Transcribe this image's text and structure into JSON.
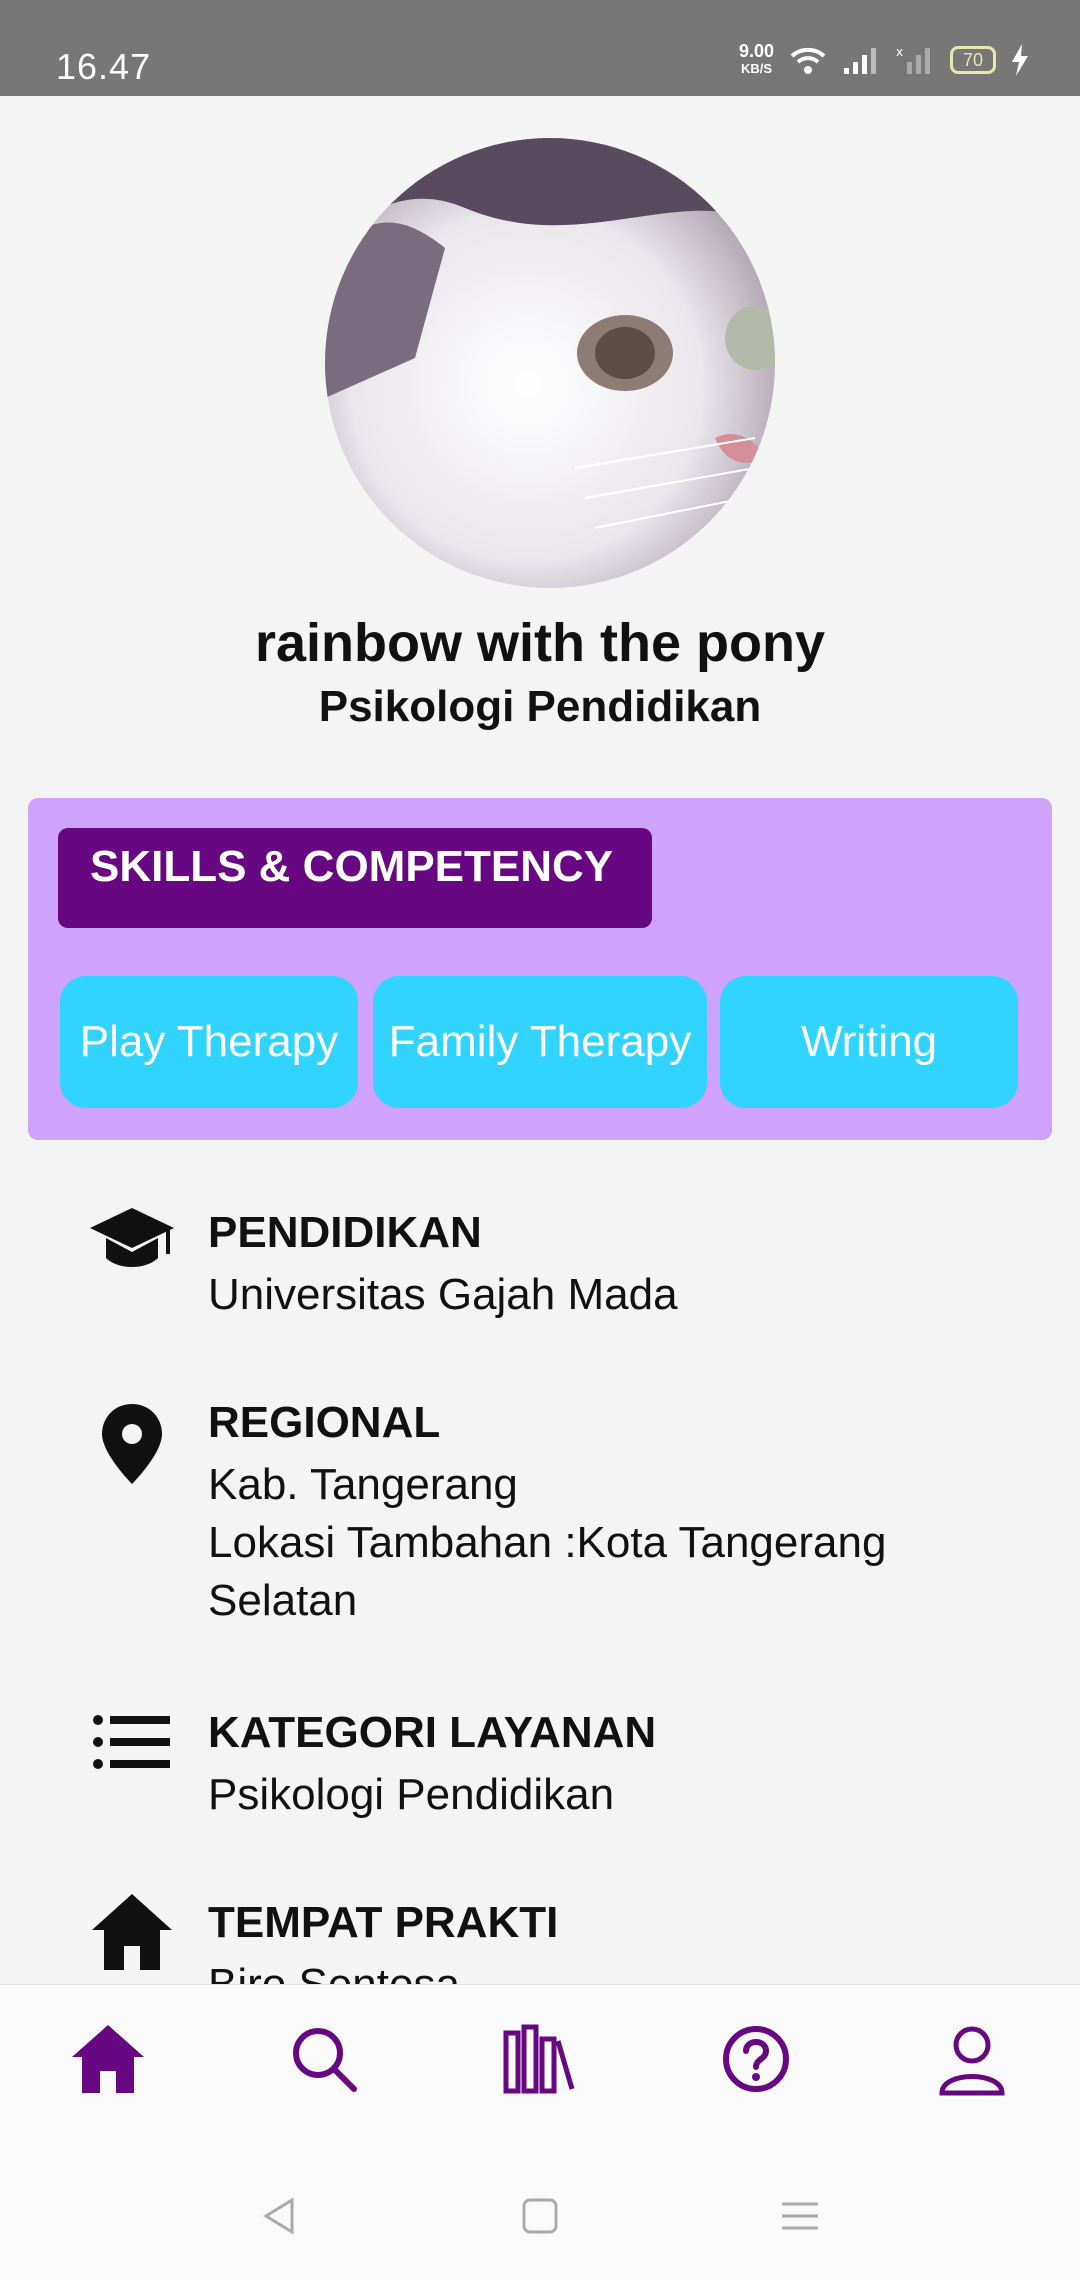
{
  "status_bar": {
    "time": "16.47",
    "net_speed_value": "9.00",
    "net_speed_unit": "KB/S",
    "battery_level": "70",
    "icons": [
      "wifi-icon",
      "signal-icon",
      "signal-no-service-icon",
      "battery-icon",
      "charging-icon"
    ]
  },
  "profile": {
    "name": "rainbow with the pony",
    "specialty": "Psikologi Pendidikan",
    "avatar": "cat-photo"
  },
  "skills": {
    "title": "SKILLS & COMPETENCY",
    "items": [
      "Play Therapy",
      "Family Therapy",
      "Writing"
    ]
  },
  "info": {
    "education": {
      "title": "PENDIDIKAN",
      "value": "Universitas Gajah Mada",
      "icon": "graduation-cap-icon"
    },
    "regional": {
      "title": "REGIONAL",
      "line1": "Kab. Tangerang",
      "line2": "Lokasi Tambahan :Kota Tangerang",
      "line3": "Selatan",
      "icon": "location-pin-icon"
    },
    "category": {
      "title": "KATEGORI LAYANAN",
      "value": "Psikologi Pendidikan",
      "icon": "list-icon"
    },
    "practice": {
      "title": "TEMPAT PRAKTI",
      "value": "Biro Sentosa",
      "icon": "house-icon"
    }
  },
  "bottom_nav": {
    "items": [
      "home-icon",
      "search-icon",
      "library-icon",
      "help-icon",
      "profile-icon"
    ],
    "active": "home-icon"
  },
  "colors": {
    "accent": "#670882",
    "skills_card": "#cfa3fc",
    "chip": "#31d4ff",
    "status_bar": "#777777"
  }
}
